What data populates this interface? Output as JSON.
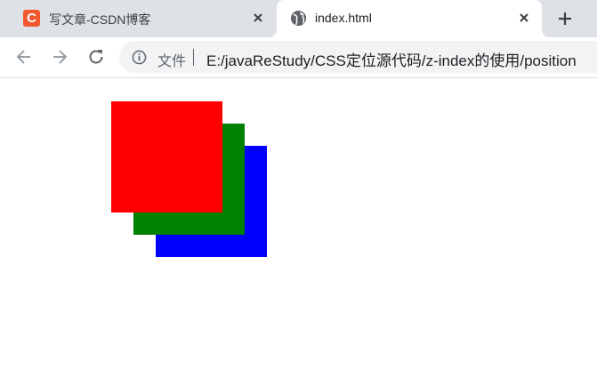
{
  "tabs": [
    {
      "title": "写文章-CSDN博客",
      "favicon": "C",
      "icon": "csdn-icon",
      "active": false
    },
    {
      "title": "index.html",
      "icon": "globe-icon",
      "active": true
    }
  ],
  "toolbar": {
    "scheme_label": "文件",
    "url": "E:/javaReStudy/CSS定位源代码/z-index的使用/position"
  },
  "page": {
    "boxes": [
      {
        "name": "red-box",
        "color": "#ff0000"
      },
      {
        "name": "green-box",
        "color": "#008000"
      },
      {
        "name": "blue-box",
        "color": "#0000ff"
      }
    ]
  }
}
